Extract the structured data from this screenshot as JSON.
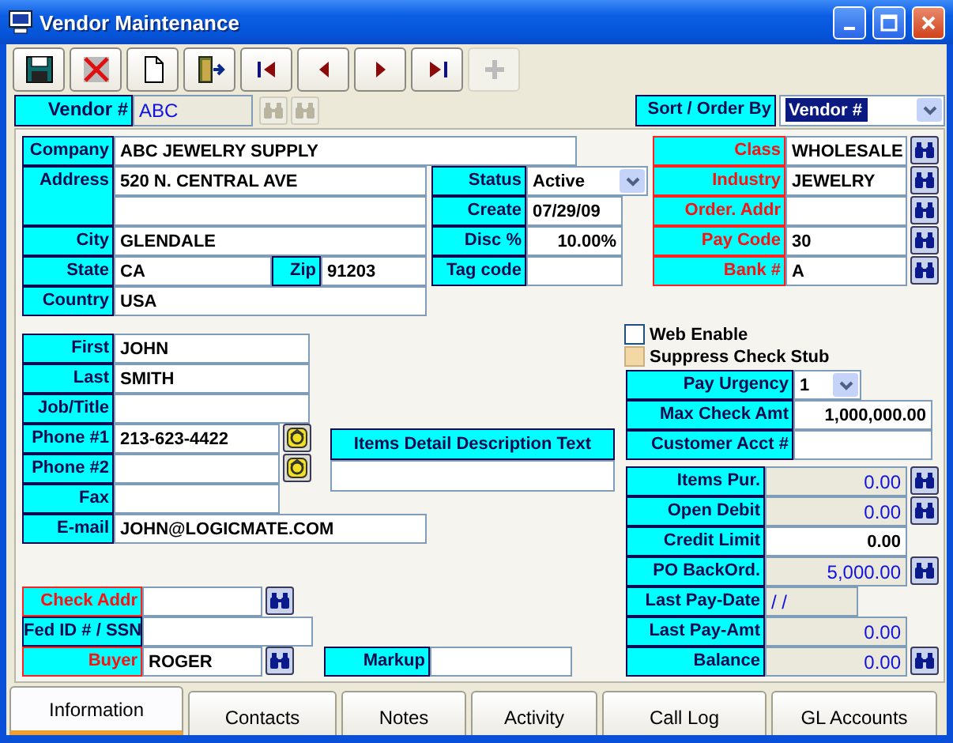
{
  "window": {
    "title": "Vendor Maintenance"
  },
  "toolbar": [
    {
      "kind": "save",
      "disabled": false
    },
    {
      "kind": "delete",
      "disabled": false
    },
    {
      "kind": "new",
      "disabled": false
    },
    {
      "kind": "exit",
      "disabled": false
    },
    {
      "kind": "first",
      "disabled": false
    },
    {
      "kind": "previous",
      "disabled": false
    },
    {
      "kind": "next",
      "disabled": false
    },
    {
      "kind": "last",
      "disabled": false
    },
    {
      "kind": "add",
      "disabled": true
    }
  ],
  "vendor": {
    "label": "Vendor #",
    "value": "ABC",
    "lookups": [
      {
        "disabled": true
      },
      {
        "disabled": true
      }
    ]
  },
  "sort": {
    "label": "Sort / Order By",
    "value": "Vendor #",
    "focused": true
  },
  "address": [
    {
      "label": "Company",
      "value": "ABC JEWELRY SUPPLY",
      "kind": "text"
    },
    {
      "label": "Address",
      "value": "520 N. CENTRAL AVE",
      "kind": "text"
    },
    {
      "kind": "text"
    },
    {
      "label": "City",
      "value": "GLENDALE",
      "kind": "text"
    },
    {
      "label": "State",
      "value": "CA",
      "kind": "text"
    },
    {
      "label": "Zip",
      "value": "91203",
      "kind": "text"
    },
    {
      "label": "Country",
      "value": "USA",
      "kind": "text"
    }
  ],
  "status": [
    {
      "label": "Status",
      "value": "Active",
      "kind": "dropdown"
    },
    {
      "label": "Create",
      "value": "07/29/09",
      "kind": "text"
    },
    {
      "label": "Disc %",
      "value": "10.00%",
      "kind": "text"
    },
    {
      "label": "Tag code",
      "kind": "text"
    }
  ],
  "codes": [
    {
      "label": "Class",
      "value": "WHOLESALE",
      "kind": "text",
      "required": true,
      "lookup": true
    },
    {
      "label": "Industry",
      "value": "JEWELRY",
      "kind": "text",
      "required": true,
      "lookup": true
    },
    {
      "label": "Order. Addr",
      "kind": "text",
      "required": true,
      "lookup": true
    },
    {
      "label": "Pay Code",
      "value": "30",
      "kind": "text",
      "required": true,
      "lookup": true
    },
    {
      "label": "Bank #",
      "value": "A",
      "kind": "text",
      "required": true,
      "lookup": true
    }
  ],
  "contact": [
    {
      "label": "First",
      "value": "JOHN",
      "kind": "text"
    },
    {
      "label": "Last",
      "value": "SMITH",
      "kind": "text"
    },
    {
      "label": "Job/Title",
      "kind": "text"
    },
    {
      "label": "Phone #1",
      "value": "213-623-4422",
      "kind": "text",
      "dial": true
    },
    {
      "label": "Phone #2",
      "kind": "text",
      "dial": true
    },
    {
      "label": "Fax",
      "kind": "text"
    },
    {
      "label": "E-mail",
      "value": "JOHN@LOGICMATE.COM",
      "kind": "text"
    }
  ],
  "items_detail": {
    "label": "Items Detail Description Text"
  },
  "options": [
    {
      "label": "Web Enable",
      "checked": false,
      "disabled": false
    },
    {
      "label": "Suppress Check Stub",
      "checked": false,
      "disabled": true
    }
  ],
  "payment": [
    {
      "label": "Pay Urgency",
      "value": "1",
      "kind": "dropdown"
    },
    {
      "label": "Max Check Amt",
      "value": "1,000,000.00",
      "kind": "text"
    },
    {
      "label": "Customer Acct #",
      "kind": "text"
    }
  ],
  "balances": [
    {
      "label": "Items Pur.",
      "value": "0.00",
      "kind": "readonly",
      "lookup": true
    },
    {
      "label": "Open Debit",
      "value": "0.00",
      "kind": "readonly",
      "lookup": true
    },
    {
      "label": "Credit Limit",
      "value": "0.00",
      "kind": "text"
    },
    {
      "label": "PO BackOrd.",
      "value": "5,000.00",
      "kind": "readonly",
      "lookup": true
    },
    {
      "label": "Last Pay-Date",
      "value": "/ /",
      "kind": "readonly"
    },
    {
      "label": "Last Pay-Amt",
      "value": "0.00",
      "kind": "readonly"
    },
    {
      "label": "Balance",
      "value": "0.00",
      "kind": "readonly",
      "lookup": true
    }
  ],
  "other": [
    {
      "label": "Check Addr",
      "kind": "text",
      "required": true,
      "lookup": true
    },
    {
      "label": "Fed ID # / SSN",
      "kind": "text",
      "required": false
    },
    {
      "label": "Buyer",
      "value": "ROGER",
      "kind": "text",
      "required": true,
      "lookup": true
    },
    {
      "label": "Markup",
      "kind": "text"
    }
  ],
  "tabs": [
    {
      "label": "Information",
      "selected": true
    },
    {
      "label": "Contacts",
      "selected": false
    },
    {
      "label": "Notes",
      "selected": false
    },
    {
      "label": "Activity",
      "selected": false
    },
    {
      "label": "Call Log",
      "selected": false
    },
    {
      "label": "GL Accounts",
      "selected": false
    }
  ]
}
